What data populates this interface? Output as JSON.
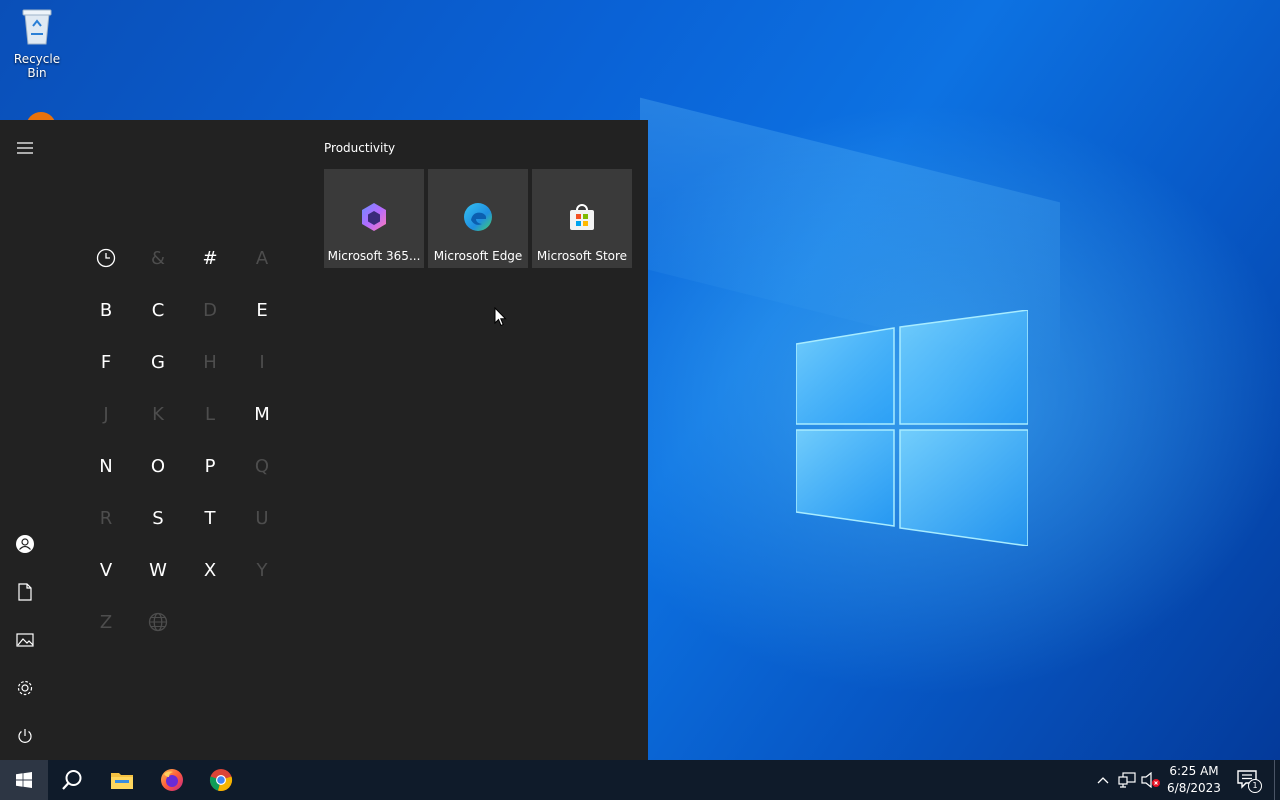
{
  "desktop": {
    "icons": [
      {
        "label": "Recycle Bin",
        "icon": "recycle-bin-icon"
      },
      {
        "label": "",
        "icon": "app-icon"
      }
    ]
  },
  "start_menu": {
    "rail": {
      "top": [
        "hamburger-menu-icon"
      ],
      "bottom": [
        "user-icon",
        "documents-icon",
        "pictures-icon",
        "settings-icon",
        "power-icon"
      ]
    },
    "jump_list": [
      {
        "label": "clock",
        "enabled": true,
        "icon": true
      },
      {
        "label": "&",
        "enabled": false
      },
      {
        "label": "#",
        "enabled": true
      },
      {
        "label": "A",
        "enabled": false
      },
      {
        "label": "B",
        "enabled": true
      },
      {
        "label": "C",
        "enabled": true
      },
      {
        "label": "D",
        "enabled": false
      },
      {
        "label": "E",
        "enabled": true
      },
      {
        "label": "F",
        "enabled": true
      },
      {
        "label": "G",
        "enabled": true
      },
      {
        "label": "H",
        "enabled": false
      },
      {
        "label": "I",
        "enabled": false
      },
      {
        "label": "J",
        "enabled": false
      },
      {
        "label": "K",
        "enabled": false
      },
      {
        "label": "L",
        "enabled": false
      },
      {
        "label": "M",
        "enabled": true
      },
      {
        "label": "N",
        "enabled": true
      },
      {
        "label": "O",
        "enabled": true
      },
      {
        "label": "P",
        "enabled": true
      },
      {
        "label": "Q",
        "enabled": false
      },
      {
        "label": "R",
        "enabled": false
      },
      {
        "label": "S",
        "enabled": true
      },
      {
        "label": "T",
        "enabled": true
      },
      {
        "label": "U",
        "enabled": false
      },
      {
        "label": "V",
        "enabled": true
      },
      {
        "label": "W",
        "enabled": true
      },
      {
        "label": "X",
        "enabled": true
      },
      {
        "label": "Y",
        "enabled": false
      },
      {
        "label": "Z",
        "enabled": false
      },
      {
        "label": "globe",
        "enabled": false,
        "icon": true
      }
    ],
    "tiles_group": {
      "title": "Productivity",
      "tiles": [
        {
          "label": "Microsoft 365...",
          "icon": "microsoft-365-icon"
        },
        {
          "label": "Microsoft Edge",
          "icon": "edge-icon"
        },
        {
          "label": "Microsoft Store",
          "icon": "store-icon"
        }
      ]
    }
  },
  "taskbar": {
    "apps": [
      "start-icon",
      "search-icon",
      "file-explorer-icon",
      "firefox-icon",
      "chrome-icon"
    ],
    "tray": {
      "icons": [
        "chevron-up-icon",
        "network-icon",
        "volume-muted-icon"
      ],
      "time": "6:25 AM",
      "date": "6/8/2023",
      "notification_count": "1"
    }
  },
  "colors": {
    "start_bg": "#222222",
    "tile_bg": "#3a3a3a",
    "taskbar_bg": "#0f1b2a",
    "disabled_letter": "#4d4d4d"
  }
}
